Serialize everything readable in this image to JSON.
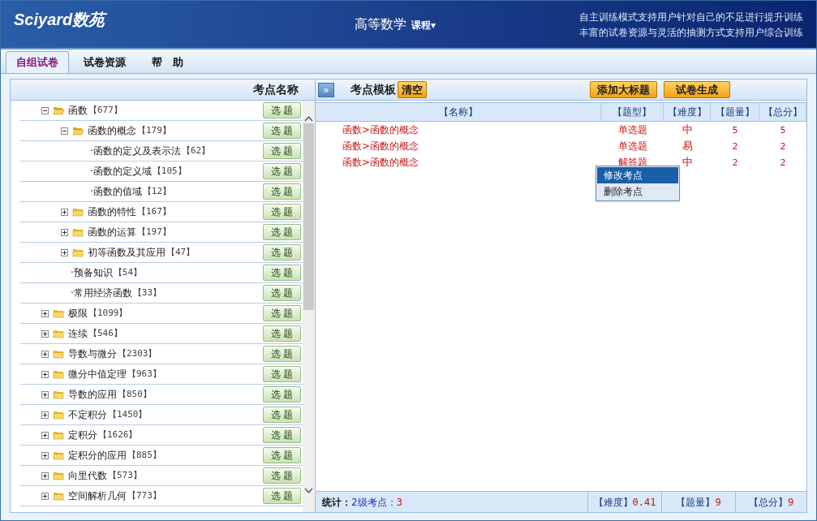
{
  "header": {
    "logo": "Sciyard数苑",
    "course": "高等数学",
    "course_menu": "课程▾",
    "slogans": [
      "自主训练模式支持用户针对自己的不足进行提升训练",
      "丰富的试卷资源与灵活的抽测方式支持用户综合训练"
    ]
  },
  "tabs": [
    {
      "label": "自组试卷",
      "selected": true
    },
    {
      "label": "试卷资源",
      "selected": false
    },
    {
      "label": "帮　助",
      "selected": false
    }
  ],
  "tree": {
    "title": "考点名称",
    "items": [
      {
        "kind": "folder",
        "label": "函数",
        "count": "【677】",
        "button": "选 题",
        "expanded": true,
        "children": [
          {
            "kind": "folder",
            "label": "函数的概念",
            "count": "【179】",
            "button": "选 题",
            "expanded": true,
            "children": [
              {
                "kind": "leaf",
                "label": "·函数的定义及表示法",
                "count": "【62】",
                "button": "选 题"
              },
              {
                "kind": "leaf",
                "label": "·函数的定义域",
                "count": "【105】",
                "button": "选 题"
              },
              {
                "kind": "leaf",
                "label": "·函数的值域",
                "count": "【12】",
                "button": "选 题"
              }
            ]
          },
          {
            "kind": "folder",
            "label": "函数的特性",
            "count": "【167】",
            "button": "选 题",
            "expanded": false
          },
          {
            "kind": "folder",
            "label": "函数的运算",
            "count": "【197】",
            "button": "选 题",
            "expanded": false
          },
          {
            "kind": "folder",
            "label": "初等函数及其应用",
            "count": "【47】",
            "button": "选 题",
            "expanded": false
          },
          {
            "kind": "leaf",
            "label": "·预备知识",
            "count": "【54】",
            "button": "选 题"
          },
          {
            "kind": "leaf",
            "label": "·常用经济函数",
            "count": "【33】",
            "button": "选 题"
          }
        ]
      },
      {
        "kind": "folder",
        "label": "极限",
        "count": "【1099】",
        "button": "选 题",
        "expanded": false
      },
      {
        "kind": "folder",
        "label": "连续",
        "count": "【546】",
        "button": "选 题",
        "expanded": false
      },
      {
        "kind": "folder",
        "label": "导数与微分",
        "count": "【2303】",
        "button": "选 题",
        "expanded": false
      },
      {
        "kind": "folder",
        "label": "微分中值定理",
        "count": "【963】",
        "button": "选 题",
        "expanded": false
      },
      {
        "kind": "folder",
        "label": "导数的应用",
        "count": "【850】",
        "button": "选 题",
        "expanded": false
      },
      {
        "kind": "folder",
        "label": "不定积分",
        "count": "【1450】",
        "button": "选 题",
        "expanded": false
      },
      {
        "kind": "folder",
        "label": "定积分",
        "count": "【1626】",
        "button": "选 题",
        "expanded": false
      },
      {
        "kind": "folder",
        "label": "定积分的应用",
        "count": "【885】",
        "button": "选 题",
        "expanded": false
      },
      {
        "kind": "folder",
        "label": "向里代数",
        "count": "【573】",
        "button": "选 题",
        "expanded": false
      },
      {
        "kind": "folder",
        "label": "空间解析几何",
        "count": "【773】",
        "button": "选 题",
        "expanded": false
      }
    ]
  },
  "template": {
    "expand_button": "»",
    "title": "考点模板",
    "clear_button": "清空",
    "add_button": "添加大标题",
    "generate_button": "试卷生成",
    "columns": [
      "【名称】",
      "【题型】",
      "【难度】",
      "【题量】",
      "【总分】"
    ],
    "rows": [
      {
        "name": "函数>函数的概念",
        "type": "单选题",
        "difficulty": "中",
        "count": "5",
        "score": "5"
      },
      {
        "name": "函数>函数的概念",
        "type": "单选题",
        "difficulty": "易",
        "count": "2",
        "score": "2"
      },
      {
        "name": "函数>函数的概念",
        "type": "解答题",
        "difficulty": "中",
        "count": "2",
        "score": "2"
      }
    ],
    "context_menu": [
      {
        "label": "修改考点",
        "selected": true
      },
      {
        "label": "删除考点",
        "selected": false
      }
    ],
    "footer": {
      "label": "统计：",
      "level_label": "2级考点：",
      "level_value": "3",
      "difficulty_label": "【难度】",
      "difficulty_value": "0.41",
      "count_label": "【题量】",
      "count_value": "9",
      "score_label": "【总分】",
      "score_value": "9"
    }
  }
}
